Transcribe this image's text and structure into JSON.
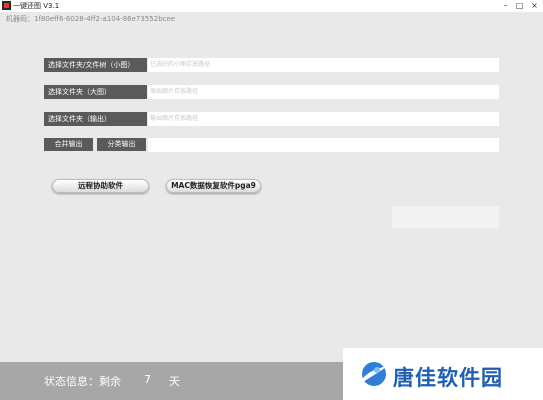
{
  "window": {
    "title": "一键还图 V3.1",
    "controls": {
      "minimize": "–",
      "maximize": "□",
      "close": "×"
    }
  },
  "machine_code": "机器码：1f80eff6-6028-4ff2-a104-86e73552bcee",
  "rows": [
    {
      "label": "选择文件夹/文件树（小图）",
      "placeholder": "已选好的小图存放路径"
    },
    {
      "label": "选择文件夹（大图）",
      "placeholder": "原始图片存放路径"
    },
    {
      "label": "选择文件夹（输出）",
      "placeholder": "输出图片存放路径"
    }
  ],
  "output_buttons": {
    "merge": "合并输出",
    "classify": "分类输出"
  },
  "buttons": {
    "remote": "远程协助软件",
    "mac": "MAC数据恢复软件pga9"
  },
  "status": {
    "label": "状态信息：剩余",
    "days": "7",
    "unit": "天"
  },
  "watermark": {
    "text": "唐佳软件园",
    "color": "#1e5fb4"
  }
}
